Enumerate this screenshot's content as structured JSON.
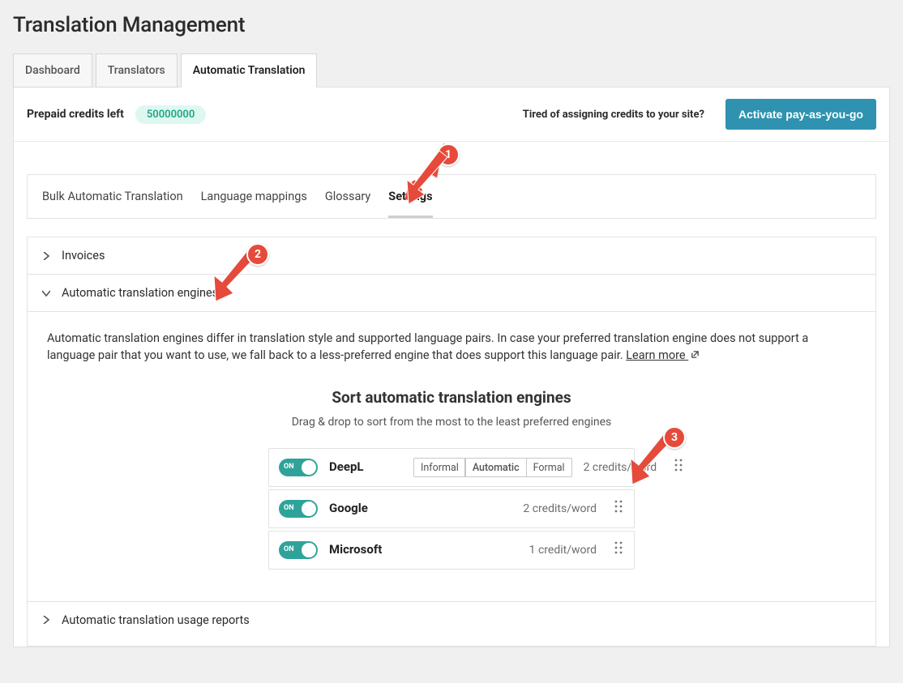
{
  "page": {
    "title": "Translation Management"
  },
  "top_tabs": [
    {
      "label": "Dashboard",
      "active": false
    },
    {
      "label": "Translators",
      "active": false
    },
    {
      "label": "Automatic Translation",
      "active": true
    }
  ],
  "strip": {
    "credits_label": "Prepaid credits left",
    "credits_value": "50000000",
    "tired_text": "Tired of assigning credits to your site?",
    "cta_label": "Activate pay-as-you-go"
  },
  "subtabs": [
    {
      "label": "Bulk Automatic Translation",
      "active": false
    },
    {
      "label": "Language mappings",
      "active": false
    },
    {
      "label": "Glossary",
      "active": false
    },
    {
      "label": "Settings",
      "active": true
    }
  ],
  "accordions": {
    "invoices": {
      "label": "Invoices",
      "expanded": false
    },
    "engines": {
      "label": "Automatic translation engines",
      "expanded": true
    },
    "usage": {
      "label": "Automatic translation usage reports",
      "expanded": false
    }
  },
  "engines_panel": {
    "intro": "Automatic translation engines differ in translation style and supported language pairs. In case your preferred translation engine does not support a language pair that you want to use, we fall back to a less-preferred engine that does support this language pair.",
    "learn_more": "Learn more",
    "sort_title": "Sort automatic translation engines",
    "sort_subtitle": "Drag & drop to sort from the most to the least preferred engines",
    "formality_options": [
      "Informal",
      "Automatic",
      "Formal"
    ],
    "engines": [
      {
        "name": "DeepL",
        "on_text": "ON",
        "formality": "Automatic",
        "credits": "2 credits/word",
        "has_formality": true
      },
      {
        "name": "Google",
        "on_text": "ON",
        "credits": "2 credits/word",
        "has_formality": false
      },
      {
        "name": "Microsoft",
        "on_text": "ON",
        "credits": "1 credit/word",
        "has_formality": false
      }
    ]
  },
  "annotations": {
    "a1": "1",
    "a2": "2",
    "a3": "3"
  }
}
